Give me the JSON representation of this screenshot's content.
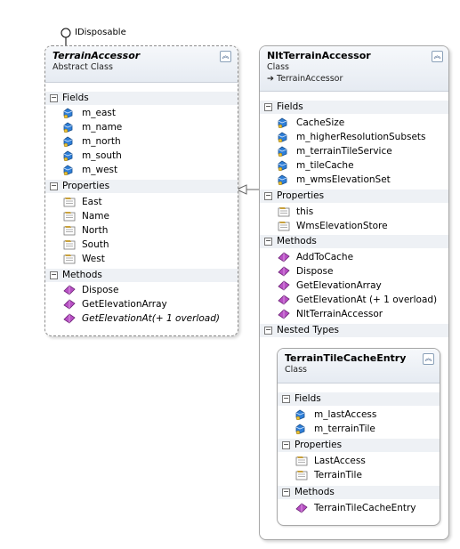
{
  "interface_label": "IDisposable",
  "terrain_accessor": {
    "name": "TerrainAccessor",
    "kind": "Abstract Class",
    "sections": {
      "fields": "Fields",
      "properties": "Properties",
      "methods": "Methods"
    },
    "fields": [
      "m_east",
      "m_name",
      "m_north",
      "m_south",
      "m_west"
    ],
    "properties": [
      "East",
      "Name",
      "North",
      "South",
      "West"
    ],
    "methods": [
      {
        "name": "Dispose",
        "italic": false
      },
      {
        "name": "GetElevationArray",
        "italic": false
      },
      {
        "name": "GetElevationAt(+ 1 overload)",
        "italic": true
      }
    ]
  },
  "nlt_accessor": {
    "name": "NltTerrainAccessor",
    "kind": "Class",
    "base": "TerrainAccessor",
    "sections": {
      "fields": "Fields",
      "properties": "Properties",
      "methods": "Methods",
      "nested": "Nested Types"
    },
    "fields": [
      "CacheSize",
      "m_higherResolutionSubsets",
      "m_terrainTileService",
      "m_tileCache",
      "m_wmsElevationSet"
    ],
    "properties": [
      "this",
      "WmsElevationStore"
    ],
    "methods": [
      "AddToCache",
      "Dispose",
      "GetElevationArray",
      "GetElevationAt (+ 1 overload)",
      "NltTerrainAccessor"
    ]
  },
  "nested_entry": {
    "name": "TerrainTileCacheEntry",
    "kind": "Class",
    "sections": {
      "fields": "Fields",
      "properties": "Properties",
      "methods": "Methods"
    },
    "fields": [
      "m_lastAccess",
      "m_terrainTile"
    ],
    "properties": [
      "LastAccess",
      "TerrainTile"
    ],
    "methods": [
      "TerrainTileCacheEntry"
    ]
  },
  "colors": {
    "header_top": "#f6f8fb",
    "header_bottom": "#e6ebf2",
    "section_bg": "#eef1f5",
    "field_icon": "#2f7fd8",
    "property_icon": "#c8a03a",
    "method_icon": "#b84fc4"
  }
}
